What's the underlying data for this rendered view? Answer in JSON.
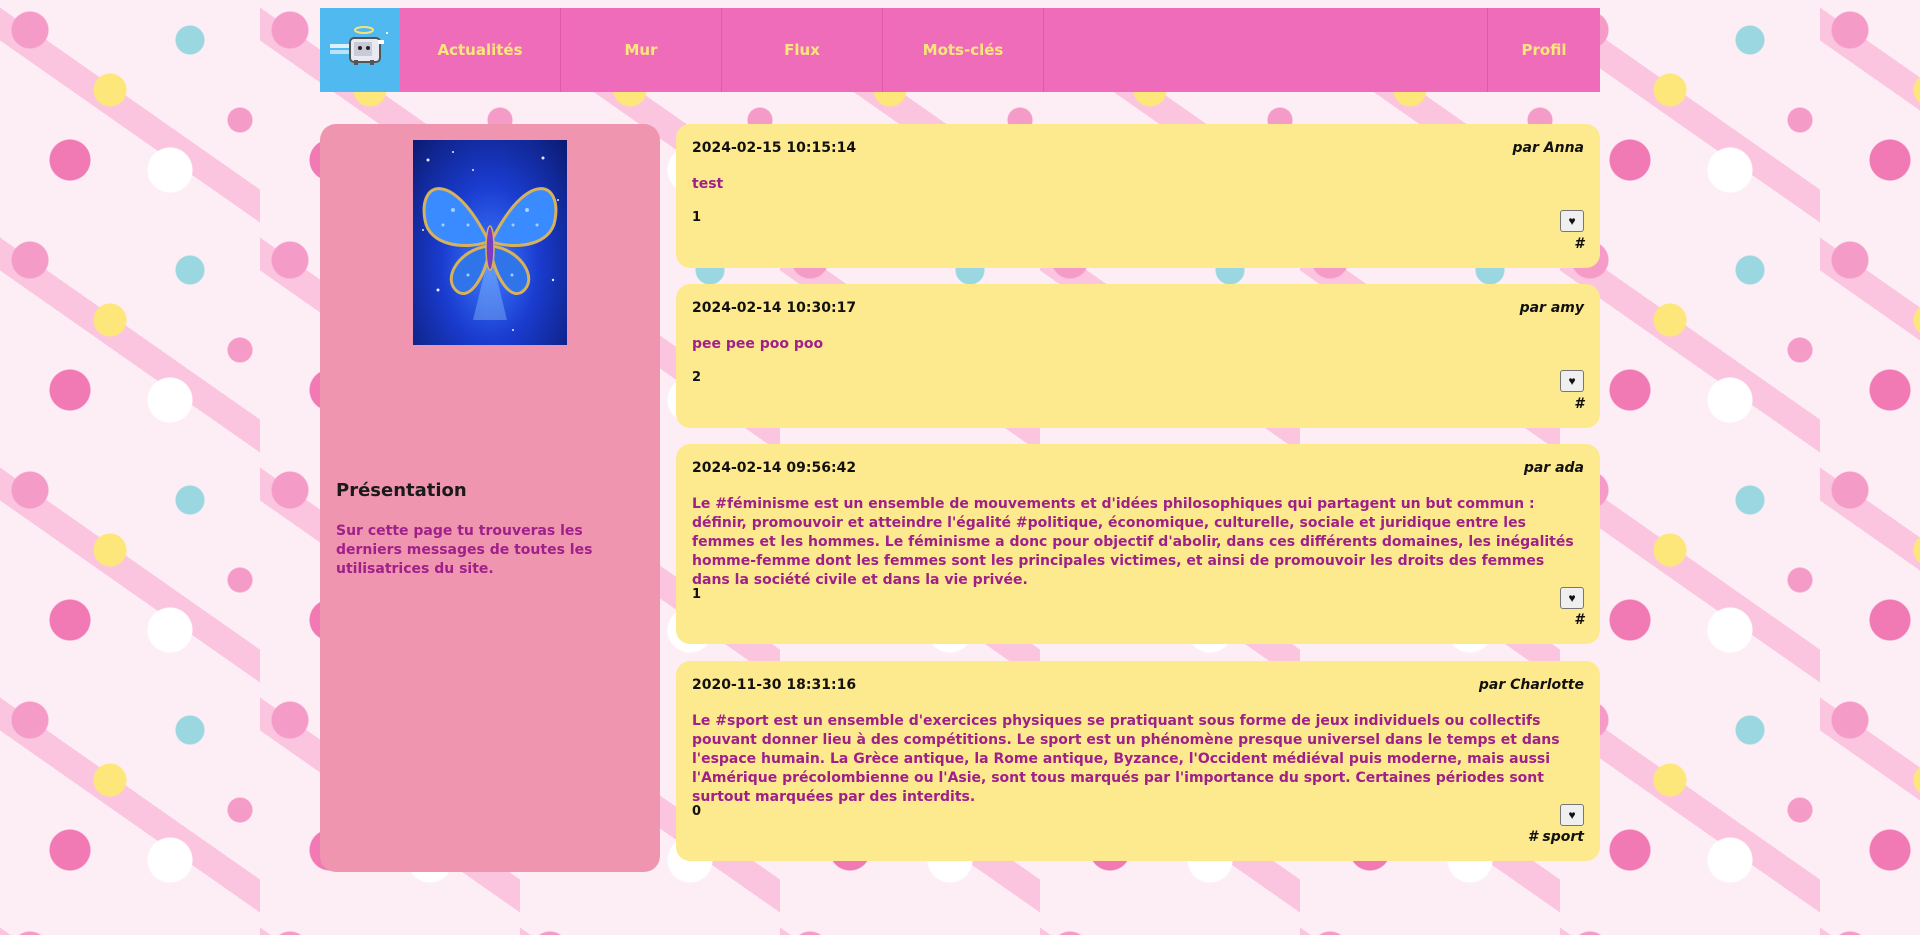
{
  "nav": {
    "logo_icon": "nyan-cat-icon",
    "links": [
      "Actualités",
      "Mur",
      "Flux",
      "Mots-clés"
    ],
    "profile": "Profil"
  },
  "sidebar": {
    "avatar": "glitter-butterfly-image",
    "heading": "Présentation",
    "description": "Sur cette page tu trouveras les derniers messages de toutes les utilisatrices du site."
  },
  "posts": [
    {
      "date": "2024-02-15 10:15:14",
      "author": "par Anna",
      "content": "test",
      "likes": "1",
      "like_label": "♥",
      "tags": "#"
    },
    {
      "date": "2024-02-14 10:30:17",
      "author": "par amy",
      "content": "pee pee poo poo",
      "likes": "2",
      "like_label": "♥",
      "tags": "#"
    },
    {
      "date": "2024-02-14 09:56:42",
      "author": "par ada",
      "content": "Le #féminisme est un ensemble de mouvements et d'idées philosophiques qui partagent un but commun : définir, promouvoir et atteindre l'égalité #politique, économique, culturelle, sociale et juridique entre les femmes et les hommes. Le féminisme a donc pour objectif d'abolir, dans ces différents domaines, les inégalités homme-femme dont les femmes sont les principales victimes, et ainsi de promouvoir les droits des femmes dans la société civile et dans la vie privée.",
      "likes": "1",
      "like_label": "♥",
      "tags": "#"
    },
    {
      "date": "2020-11-30 18:31:16",
      "author": "par Charlotte",
      "content": "Le #sport est un ensemble d'exercices physiques se pratiquant sous forme de jeux individuels ou collectifs pouvant donner lieu à des compétitions. Le sport est un phénomène presque universel dans le temps et dans l'espace humain. La Grèce antique, la Rome antique, Byzance, l'Occident médiéval puis moderne, mais aussi l'Amérique précolombienne ou l'Asie, sont tous marqués par l'importance du sport. Certaines périodes sont surtout marquées par des interdits.",
      "likes": "0",
      "like_label": "♥",
      "tags": "# sport"
    }
  ]
}
